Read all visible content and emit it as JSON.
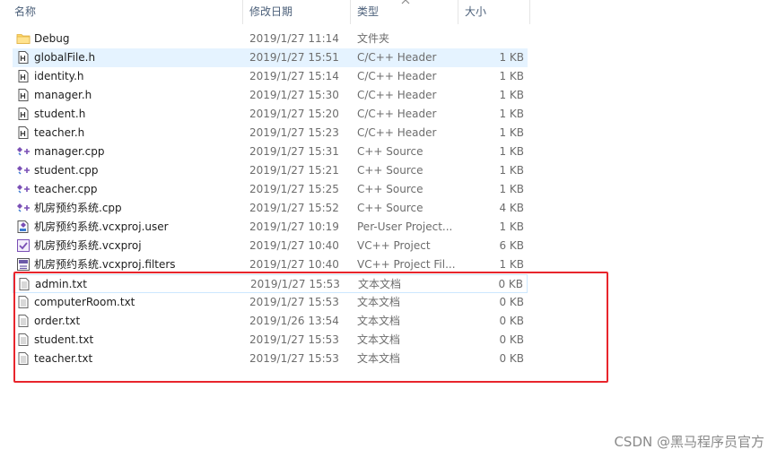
{
  "columns": {
    "name": "名称",
    "date": "修改日期",
    "type": "类型",
    "size": "大小"
  },
  "files": [
    {
      "name": "Debug",
      "date": "2019/1/27 11:14",
      "type": "文件夹",
      "size": "",
      "icon": "folder-icon"
    },
    {
      "name": "globalFile.h",
      "date": "2019/1/27 15:51",
      "type": "C/C++ Header",
      "size": "1 KB",
      "icon": "header-file-icon",
      "selected": true
    },
    {
      "name": "identity.h",
      "date": "2019/1/27 15:14",
      "type": "C/C++ Header",
      "size": "1 KB",
      "icon": "header-file-icon"
    },
    {
      "name": "manager.h",
      "date": "2019/1/27 15:30",
      "type": "C/C++ Header",
      "size": "1 KB",
      "icon": "header-file-icon"
    },
    {
      "name": "student.h",
      "date": "2019/1/27 15:20",
      "type": "C/C++ Header",
      "size": "1 KB",
      "icon": "header-file-icon"
    },
    {
      "name": "teacher.h",
      "date": "2019/1/27 15:23",
      "type": "C/C++ Header",
      "size": "1 KB",
      "icon": "header-file-icon"
    },
    {
      "name": "manager.cpp",
      "date": "2019/1/27 15:31",
      "type": "C++ Source",
      "size": "1 KB",
      "icon": "cpp-file-icon"
    },
    {
      "name": "student.cpp",
      "date": "2019/1/27 15:21",
      "type": "C++ Source",
      "size": "1 KB",
      "icon": "cpp-file-icon"
    },
    {
      "name": "teacher.cpp",
      "date": "2019/1/27 15:25",
      "type": "C++ Source",
      "size": "1 KB",
      "icon": "cpp-file-icon"
    },
    {
      "name": "机房预约系统.cpp",
      "date": "2019/1/27 15:52",
      "type": "C++ Source",
      "size": "4 KB",
      "icon": "cpp-file-icon"
    },
    {
      "name": "机房预约系统.vcxproj.user",
      "date": "2019/1/27 10:19",
      "type": "Per-User Project...",
      "size": "1 KB",
      "icon": "vcxproj-user-icon"
    },
    {
      "name": "机房预约系统.vcxproj",
      "date": "2019/1/27 10:40",
      "type": "VC++ Project",
      "size": "6 KB",
      "icon": "vcxproj-icon"
    },
    {
      "name": "机房预约系统.vcxproj.filters",
      "date": "2019/1/27 10:40",
      "type": "VC++ Project Fil...",
      "size": "1 KB",
      "icon": "filters-file-icon"
    },
    {
      "name": "admin.txt",
      "date": "2019/1/27 15:53",
      "type": "文本文档",
      "size": "0 KB",
      "icon": "text-file-icon",
      "outlined": true
    },
    {
      "name": "computerRoom.txt",
      "date": "2019/1/27 15:53",
      "type": "文本文档",
      "size": "0 KB",
      "icon": "text-file-icon"
    },
    {
      "name": "order.txt",
      "date": "2019/1/26 13:54",
      "type": "文本文档",
      "size": "0 KB",
      "icon": "text-file-icon"
    },
    {
      "name": "student.txt",
      "date": "2019/1/27 15:53",
      "type": "文本文档",
      "size": "0 KB",
      "icon": "text-file-icon"
    },
    {
      "name": "teacher.txt",
      "date": "2019/1/27 15:53",
      "type": "文本文档",
      "size": "0 KB",
      "icon": "text-file-icon"
    }
  ],
  "colors": {
    "selected_row": "#e5f3ff",
    "highlight_box": "#e8252c",
    "header_text": "#4c607a"
  },
  "watermark": "CSDN @黑马程序员官方"
}
